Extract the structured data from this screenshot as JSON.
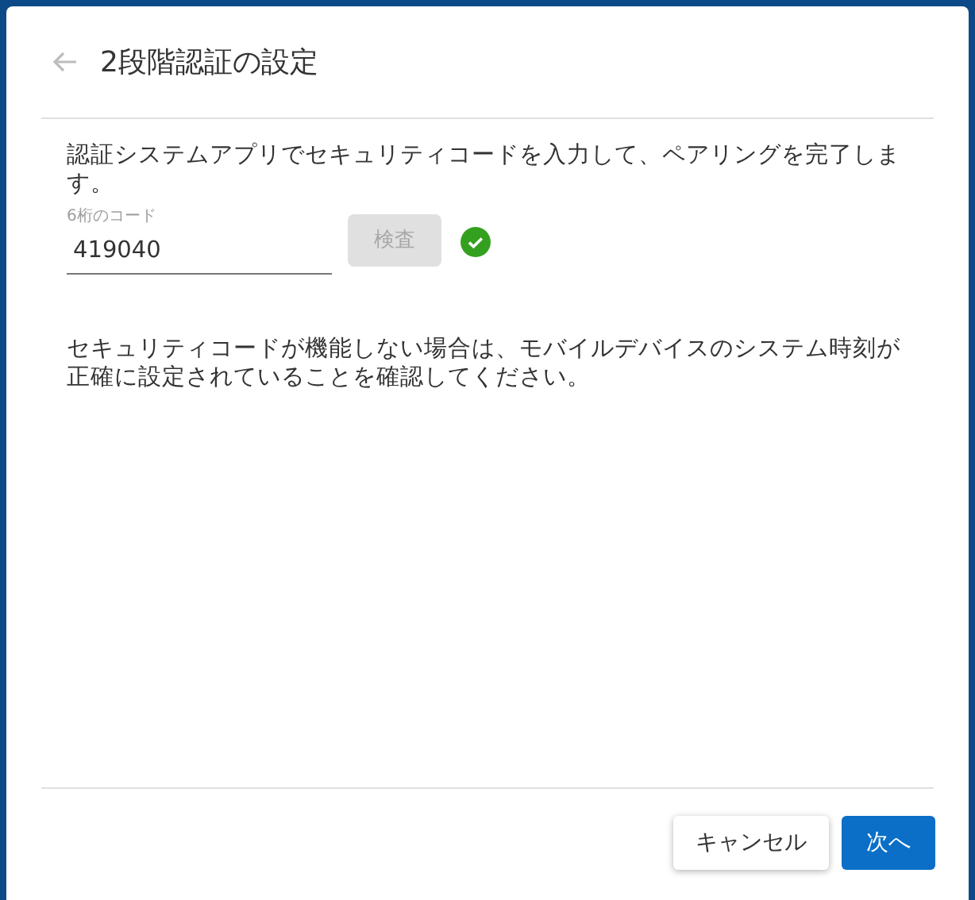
{
  "dialog": {
    "title": "2段階認証の設定",
    "instruction": "認証システムアプリでセキュリティコードを入力して、ペアリングを完了します。",
    "code_field": {
      "label": "6桁のコード",
      "value": "419040"
    },
    "verify_button": {
      "label": "検査",
      "disabled": true
    },
    "verified": true,
    "note": "セキュリティコードが機能しない場合は、モバイルデバイスのシステム時刻が正確に設定されていることを確認してください。",
    "buttons": [
      {
        "label": "キャンセル",
        "kind": "secondary"
      },
      {
        "label": "次へ",
        "kind": "primary"
      }
    ]
  }
}
